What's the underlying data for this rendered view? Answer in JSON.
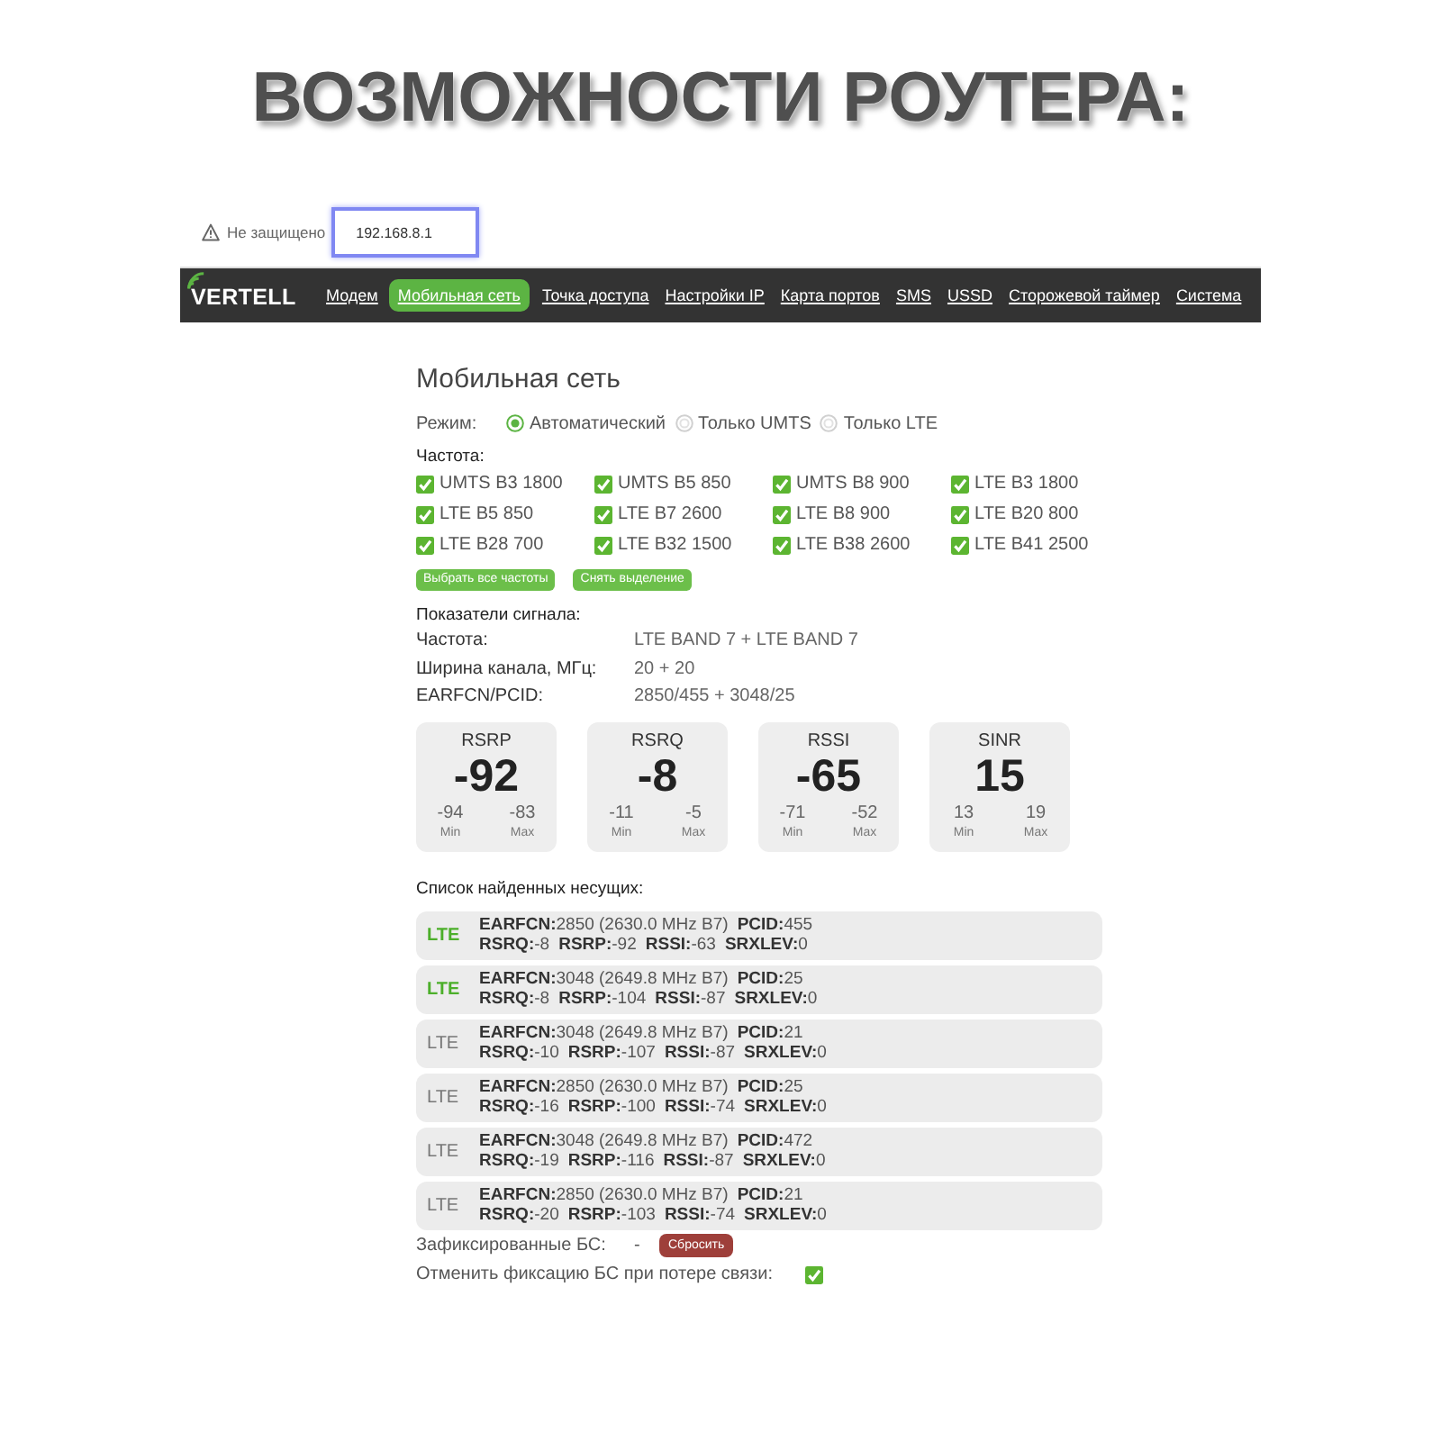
{
  "heading": {
    "title": "ВОЗМОЖНОСТИ РОУТЕРА:"
  },
  "address_bar": {
    "security": "Не защищено",
    "url": "192.168.8.1"
  },
  "nav": {
    "logo": "VERTELL",
    "items": [
      {
        "label": "Модем",
        "selected": false
      },
      {
        "label": "Мобильная сеть",
        "selected": true
      },
      {
        "label": "Точка доступа",
        "selected": false
      },
      {
        "label": "Настройки IP",
        "selected": false
      },
      {
        "label": "Карта портов",
        "selected": false
      },
      {
        "label": "SMS",
        "selected": false
      },
      {
        "label": "USSD",
        "selected": false
      },
      {
        "label": "Сторожевой таймер",
        "selected": false
      },
      {
        "label": "Система",
        "selected": false
      }
    ]
  },
  "page": {
    "title": "Мобильная сеть",
    "mode": {
      "label": "Режим:",
      "options": [
        {
          "label": "Автоматический",
          "selected": true
        },
        {
          "label": "Только UMTS",
          "selected": false
        },
        {
          "label": "Только LTE",
          "selected": false
        }
      ]
    },
    "frequencies": {
      "label": "Частота:",
      "items": [
        {
          "label": "UMTS B3 1800",
          "checked": true
        },
        {
          "label": "UMTS B5 850",
          "checked": true
        },
        {
          "label": "UMTS B8 900",
          "checked": true
        },
        {
          "label": "LTE B3 1800",
          "checked": true
        },
        {
          "label": "LTE B5 850",
          "checked": true
        },
        {
          "label": "LTE B7 2600",
          "checked": true
        },
        {
          "label": "LTE B8 900",
          "checked": true
        },
        {
          "label": "LTE B20 800",
          "checked": true
        },
        {
          "label": "LTE B28 700",
          "checked": true
        },
        {
          "label": "LTE B32 1500",
          "checked": true
        },
        {
          "label": "LTE B38 2600",
          "checked": true
        },
        {
          "label": "LTE B41 2500",
          "checked": true
        }
      ],
      "buttons": [
        "Выбрать все частоты",
        "Снять выделение"
      ]
    },
    "signal": {
      "title": "Показатели сигнала:",
      "rows": [
        {
          "label": "Частота:",
          "value": "LTE BAND 7 + LTE BAND 7"
        },
        {
          "label": "Ширина канала, МГц:",
          "value": "20 + 20"
        },
        {
          "label": "EARFCN/PCID:",
          "value": "2850/455 + 3048/25"
        }
      ],
      "tiles": [
        {
          "name": "RSRP",
          "value": "-92",
          "min": "-94",
          "max": "-83",
          "min_label": "Min",
          "max_label": "Max"
        },
        {
          "name": "RSRQ",
          "value": "-8",
          "min": "-11",
          "max": "-5",
          "min_label": "Min",
          "max_label": "Max"
        },
        {
          "name": "RSSI",
          "value": "-65",
          "min": "-71",
          "max": "-52",
          "min_label": "Min",
          "max_label": "Max"
        },
        {
          "name": "SINR",
          "value": "15",
          "min": "13",
          "max": "19",
          "min_label": "Min",
          "max_label": "Max"
        }
      ]
    },
    "carriers": {
      "title": "Список найденных несущих:",
      "items": [
        {
          "tech": "LTE",
          "active": true,
          "line_1": [
            {
              "label": "EARFCN:",
              "value": "2850 (2630.0 MHz B7)"
            },
            {
              "label": "PCID:",
              "value": "455"
            }
          ],
          "line_2": [
            {
              "label": "RSRQ:",
              "value": "-8"
            },
            {
              "label": "RSRP:",
              "value": "-92"
            },
            {
              "label": "RSSI:",
              "value": "-63"
            },
            {
              "label": "SRXLEV:",
              "value": "0"
            }
          ]
        },
        {
          "tech": "LTE",
          "active": true,
          "line_1": [
            {
              "label": "EARFCN:",
              "value": "3048 (2649.8 MHz B7)"
            },
            {
              "label": "PCID:",
              "value": "25"
            }
          ],
          "line_2": [
            {
              "label": "RSRQ:",
              "value": "-8"
            },
            {
              "label": "RSRP:",
              "value": "-104"
            },
            {
              "label": "RSSI:",
              "value": "-87"
            },
            {
              "label": "SRXLEV:",
              "value": "0"
            }
          ]
        },
        {
          "tech": "LTE",
          "active": false,
          "line_1": [
            {
              "label": "EARFCN:",
              "value": "3048 (2649.8 MHz B7)"
            },
            {
              "label": "PCID:",
              "value": "21"
            }
          ],
          "line_2": [
            {
              "label": "RSRQ:",
              "value": "-10"
            },
            {
              "label": "RSRP:",
              "value": "-107"
            },
            {
              "label": "RSSI:",
              "value": "-87"
            },
            {
              "label": "SRXLEV:",
              "value": "0"
            }
          ]
        },
        {
          "tech": "LTE",
          "active": false,
          "line_1": [
            {
              "label": "EARFCN:",
              "value": "2850 (2630.0 MHz B7)"
            },
            {
              "label": "PCID:",
              "value": "25"
            }
          ],
          "line_2": [
            {
              "label": "RSRQ:",
              "value": "-16"
            },
            {
              "label": "RSRP:",
              "value": "-100"
            },
            {
              "label": "RSSI:",
              "value": "-74"
            },
            {
              "label": "SRXLEV:",
              "value": "0"
            }
          ]
        },
        {
          "tech": "LTE",
          "active": false,
          "line_1": [
            {
              "label": "EARFCN:",
              "value": "3048 (2649.8 MHz B7)"
            },
            {
              "label": "PCID:",
              "value": "472"
            }
          ],
          "line_2": [
            {
              "label": "RSRQ:",
              "value": "-19"
            },
            {
              "label": "RSRP:",
              "value": "-116"
            },
            {
              "label": "RSSI:",
              "value": "-87"
            },
            {
              "label": "SRXLEV:",
              "value": "0"
            }
          ]
        },
        {
          "tech": "LTE",
          "active": false,
          "line_1": [
            {
              "label": "EARFCN:",
              "value": "2850 (2630.0 MHz B7)"
            },
            {
              "label": "PCID:",
              "value": "21"
            }
          ],
          "line_2": [
            {
              "label": "RSRQ:",
              "value": "-20"
            },
            {
              "label": "RSRP:",
              "value": "-103"
            },
            {
              "label": "RSSI:",
              "value": "-74"
            },
            {
              "label": "SRXLEV:",
              "value": "0"
            }
          ]
        }
      ]
    },
    "fixed_bs": {
      "label": "Зафиксированные БС:",
      "value": "-",
      "button": "Сбросить"
    },
    "unfix_on_loss": {
      "label": "Отменить фиксацию БС при потере связи:",
      "checked": true
    }
  }
}
